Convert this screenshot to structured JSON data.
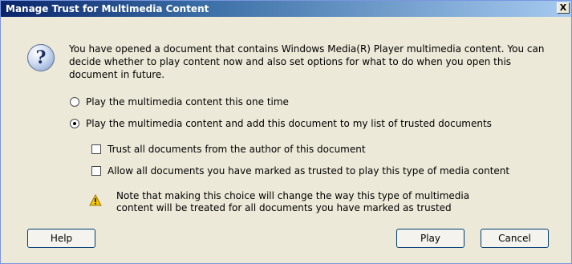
{
  "window": {
    "title": "Manage Trust for Multimedia Content",
    "close_label": "X"
  },
  "message": {
    "icon": "question-icon",
    "text": "You have opened a document that contains Windows Media(R) Player multimedia content. You can decide whether to play content now and also set options for what to do when you open this document in future."
  },
  "options": {
    "play_once": {
      "label": "Play the multimedia content this one time",
      "selected": false
    },
    "play_and_trust": {
      "label": "Play the multimedia content and add this document to my list of trusted documents",
      "selected": true
    }
  },
  "checkboxes": {
    "trust_author": {
      "label": "Trust all documents from the author of this document",
      "checked": false
    },
    "allow_all": {
      "label": "Allow all documents you have marked as trusted to play this type of media content",
      "checked": false
    }
  },
  "note": {
    "icon": "warning-icon",
    "text": "Note that making this choice will change the way this type of multimedia content will be treated for all documents you have marked as trusted"
  },
  "buttons": {
    "help": "Help",
    "play": "Play",
    "cancel": "Cancel"
  }
}
